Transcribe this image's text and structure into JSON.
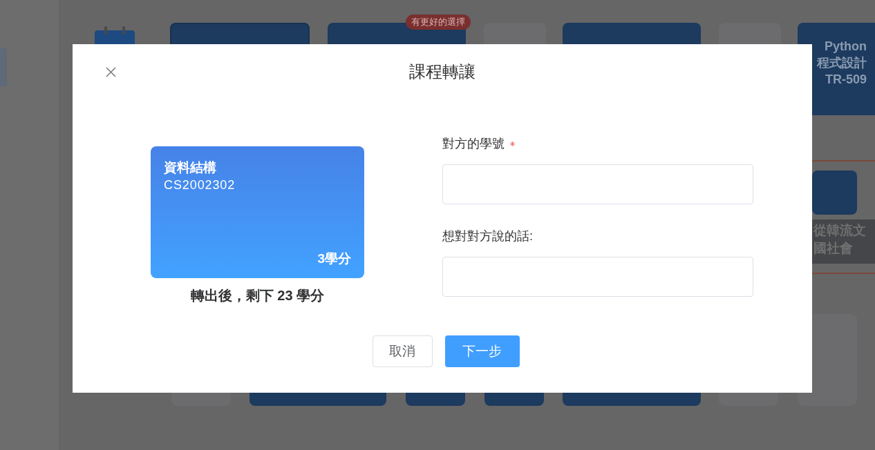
{
  "background": {
    "badge": "有更好的選擇",
    "side_course": {
      "lines": [
        "Python",
        "程式設計",
        "TR-509"
      ]
    },
    "side_label": [
      "從韓流文",
      "國社會"
    ]
  },
  "dialog": {
    "title": "課程轉讓",
    "course_card": {
      "name": "資料結構",
      "code": "CS2002302",
      "credits": "3學分"
    },
    "remaining": "轉出後，剩下 23 學分",
    "fields": [
      {
        "label": "對方的學號",
        "required": true
      },
      {
        "label": "想對對方說的話:",
        "required": false
      }
    ],
    "buttons": [
      {
        "label": "取消",
        "kind": "secondary"
      },
      {
        "label": "下一步",
        "kind": "primary"
      }
    ]
  }
}
